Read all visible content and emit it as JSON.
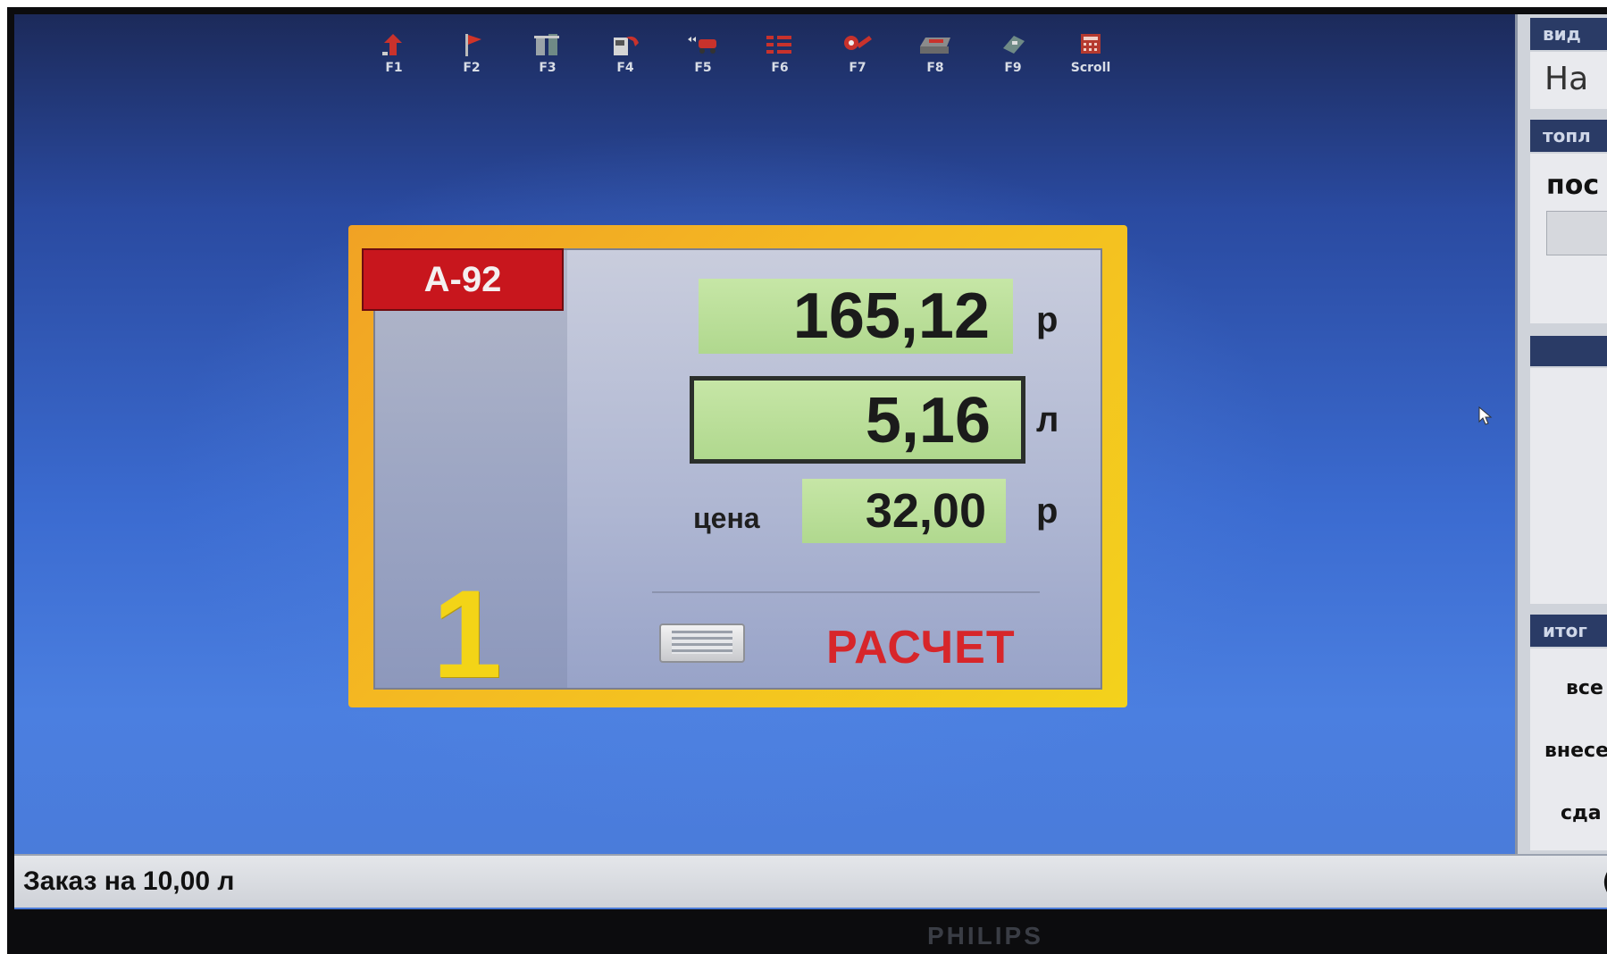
{
  "toolbar": {
    "keys": [
      {
        "label": "F1",
        "icon": "arrow-up-icon"
      },
      {
        "label": "F2",
        "icon": "flag-icon"
      },
      {
        "label": "F3",
        "icon": "dispenser-icon"
      },
      {
        "label": "F4",
        "icon": "fuel-nozzle-icon"
      },
      {
        "label": "F5",
        "icon": "tanker-icon"
      },
      {
        "label": "F6",
        "icon": "counters-icon"
      },
      {
        "label": "F7",
        "icon": "wrench-icon"
      },
      {
        "label": "F8",
        "icon": "cash-drawer-icon"
      },
      {
        "label": "F9",
        "icon": "card-icon"
      },
      {
        "label": "Scroll",
        "icon": "calculator-icon"
      }
    ]
  },
  "pump": {
    "fuel_grade": "А-92",
    "number": "1",
    "sum": "165,12",
    "sum_unit": "р",
    "volume": "5,16",
    "volume_unit": "л",
    "price_label": "цена",
    "price": "32,00",
    "price_unit": "р",
    "action_label": "РАСЧЕТ"
  },
  "right_panel": {
    "header1": "вид",
    "text1": "На",
    "header2": "топл",
    "text2": "пос",
    "header3": "итог",
    "row1": "все",
    "row2": "внесе",
    "row3": "сда"
  },
  "status": {
    "order_text": "Заказ на 10,00 л",
    "right_fragment": "("
  },
  "monitor": {
    "brand": "PHILIPS"
  },
  "colors": {
    "accent_red": "#d7262a",
    "badge_red": "#c8161d",
    "value_green": "#c6e6a6",
    "pump_number_yellow": "#f3d417",
    "card_orange": "#f1a224"
  }
}
